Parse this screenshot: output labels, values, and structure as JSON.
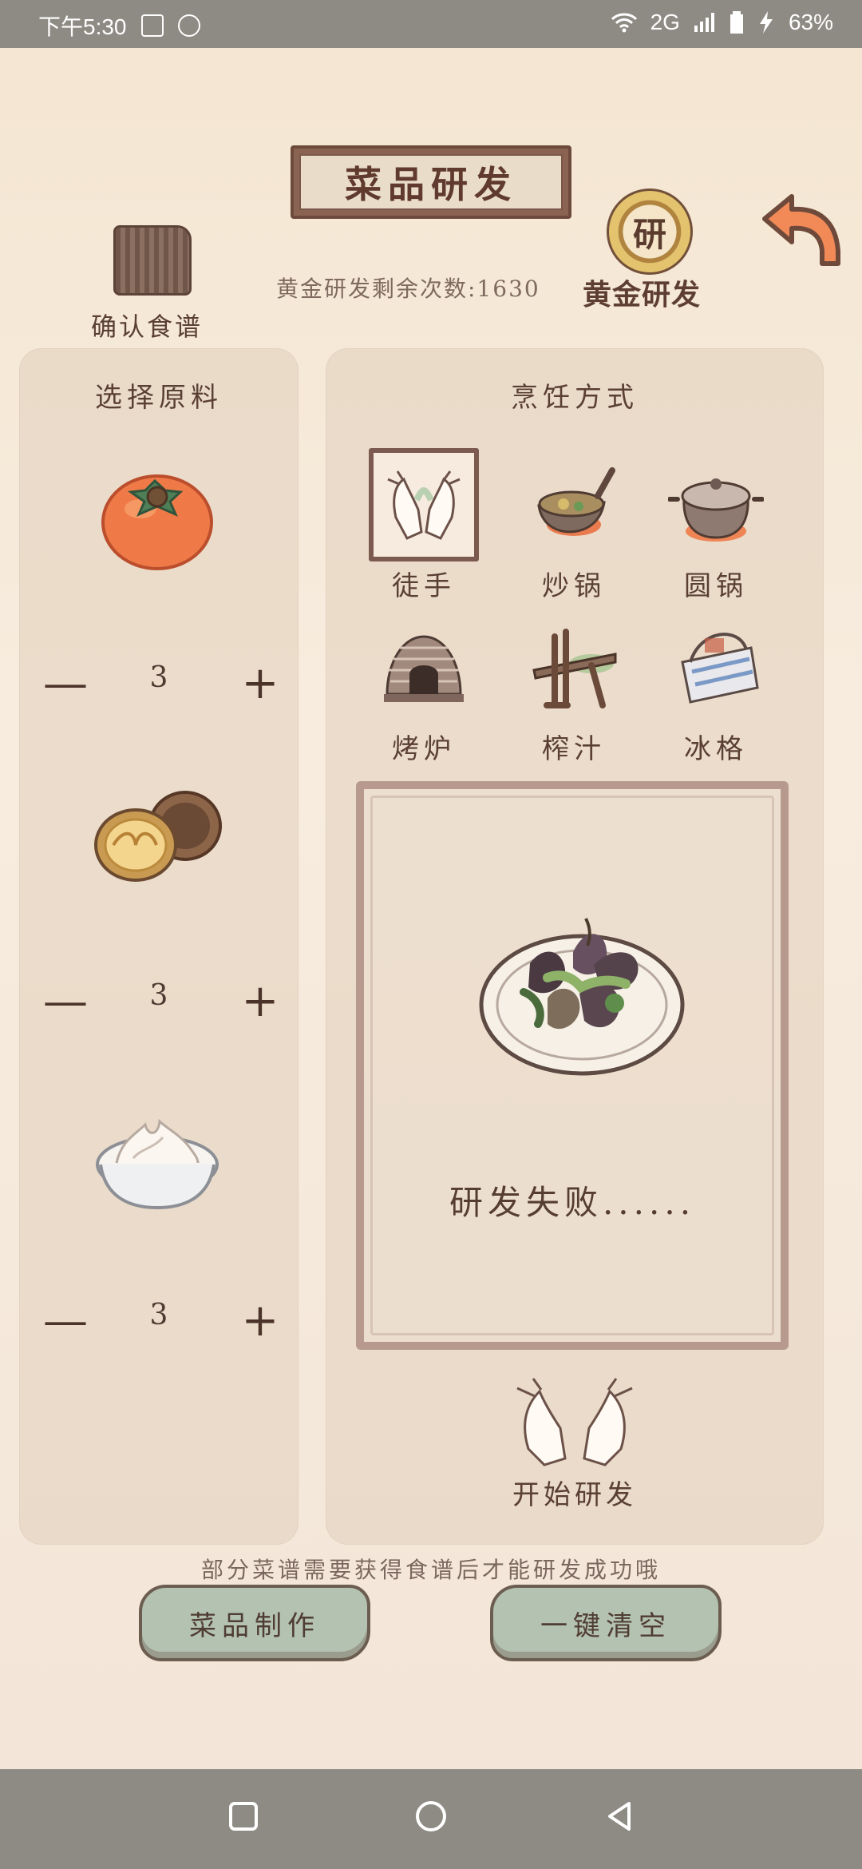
{
  "status_bar": {
    "time": "下午5:30",
    "network": "2G",
    "battery": "63%",
    "icons": [
      "image-icon",
      "download-icon",
      "wifi-icon",
      "signal-icon",
      "battery-icon",
      "charging-icon"
    ]
  },
  "header": {
    "title": "菜品研发",
    "golden_count_text": "黄金研发剩余次数:1630",
    "recipe_book_label": "确认食谱",
    "golden_dev_label": "黄金研发",
    "golden_seal_text": "研",
    "back_icon": "back-arrow-icon"
  },
  "left_panel": {
    "title": "选择原料",
    "ingredients": [
      {
        "name": "persimmon",
        "qty": "3"
      },
      {
        "name": "walnut",
        "qty": "3"
      },
      {
        "name": "cream",
        "qty": "3"
      }
    ],
    "minus_symbol": "—",
    "plus_symbol": "+"
  },
  "right_panel": {
    "title": "烹饪方式",
    "methods": [
      {
        "label": "徒手",
        "icon": "hands-icon",
        "selected": true
      },
      {
        "label": "炒锅",
        "icon": "wok-icon",
        "selected": false
      },
      {
        "label": "圆锅",
        "icon": "round-pot-icon",
        "selected": false
      },
      {
        "label": "烤炉",
        "icon": "oven-icon",
        "selected": false
      },
      {
        "label": "榨汁",
        "icon": "juicer-icon",
        "selected": false
      },
      {
        "label": "冰格",
        "icon": "ice-box-icon",
        "selected": false
      }
    ],
    "result_text": "研发失败......",
    "start_label": "开始研发"
  },
  "hint_text": "部分菜谱需要获得食谱后才能研发成功哦",
  "buttons": {
    "make": "菜品制作",
    "clear": "一键清空"
  },
  "nav_icons": [
    "recent-apps-icon",
    "home-icon",
    "back-icon"
  ],
  "colors": {
    "panel_bg": "#e6d6c4",
    "text_primary": "#5a3f33",
    "button_green": "#b4c2b1",
    "status_bar": "#8e8b84"
  }
}
